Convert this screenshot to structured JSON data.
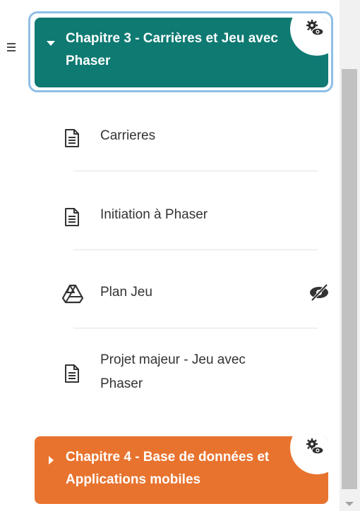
{
  "sections": [
    {
      "title": "Chapitre 3 - Carrières et Jeu avec Phaser",
      "color": "#0e7a72",
      "expanded": true,
      "visibility_icon": "gear-eye-icon",
      "activities": [
        {
          "label": "Carrieres",
          "icon": "page-icon",
          "hidden": false
        },
        {
          "label": "Initiation à Phaser",
          "icon": "page-icon",
          "hidden": false
        },
        {
          "label": "Plan Jeu",
          "icon": "google-drive-icon",
          "hidden": true
        },
        {
          "label": "Projet majeur - Jeu avec Phaser",
          "icon": "page-icon",
          "hidden": false
        }
      ]
    },
    {
      "title": "Chapitre 4 - Base de données et Applications mobiles",
      "color": "#e8732e",
      "expanded": false,
      "visibility_icon": "gear-eye-icon"
    }
  ]
}
